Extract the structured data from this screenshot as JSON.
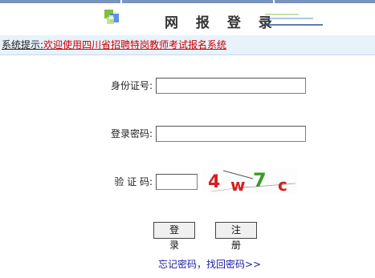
{
  "header": {
    "title": "网 报 登 录",
    "logo_icon": "colored-squares-logo-icon"
  },
  "notice": {
    "label": "系统提示:",
    "text": "欢迎使用四川省招聘特岗教师考试报名系统"
  },
  "form": {
    "id_label": "身份证号:",
    "id_value": "",
    "password_label": "登录密码:",
    "password_value": "",
    "captcha_label": "验 证 码:",
    "captcha_value": "",
    "captcha_text": "4w7c"
  },
  "buttons": {
    "login": "登 录",
    "register": "注 册"
  },
  "links": {
    "forgot_password": "忘记密码，找回密码>>"
  },
  "colors": {
    "notice_bg": "#e8f2fb",
    "notice_text": "#cc0000",
    "link": "#1a1aa6",
    "top_strip": "#7a93bf"
  }
}
